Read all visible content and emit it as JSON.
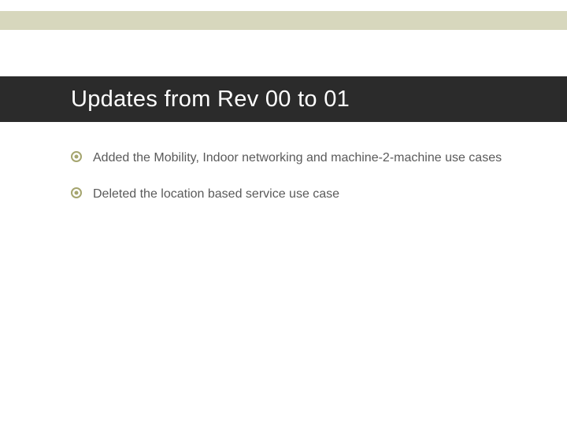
{
  "slide": {
    "title": "Updates from Rev 00 to 01",
    "bullets": [
      "Added the Mobility, Indoor networking and machine-2-machine use cases",
      "Deleted the location based service use case"
    ]
  },
  "colors": {
    "accent_bar": "#d7d7bd",
    "title_bg": "#2b2b2b",
    "title_fg": "#ffffff",
    "bullet_icon": "#a5a56f",
    "body_text": "#5a5a5a"
  }
}
